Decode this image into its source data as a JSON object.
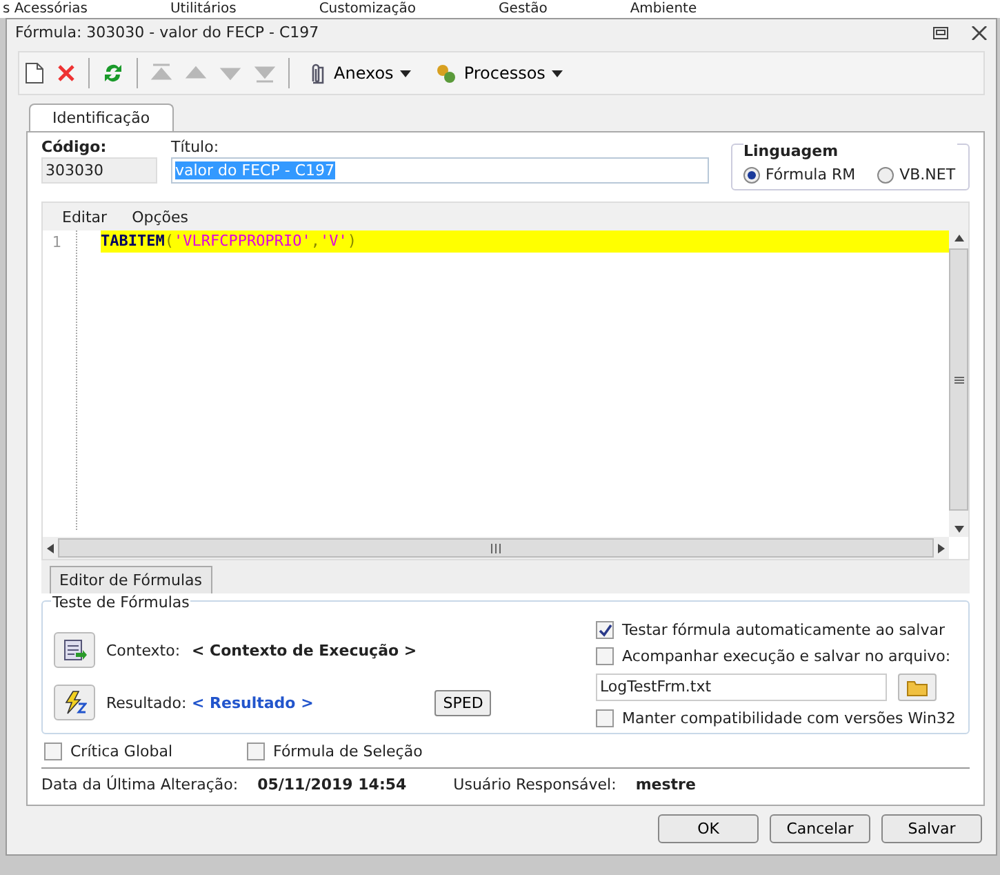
{
  "background_menu": [
    "s Acessórias",
    "Utilitários",
    "Customização",
    "Gestão",
    "Ambiente"
  ],
  "window": {
    "title": "Fórmula: 303030 - valor do FECP - C197"
  },
  "toolbar": [
    {
      "kind": "new",
      "disabled": false
    },
    {
      "kind": "delete",
      "disabled": false
    },
    {
      "kind": "refresh",
      "disabled": false
    },
    {
      "kind": "first",
      "disabled": true
    },
    {
      "kind": "up",
      "disabled": true
    },
    {
      "kind": "down",
      "disabled": true
    },
    {
      "kind": "last",
      "disabled": true
    }
  ],
  "toolbar_menus": [
    {
      "kind": "attach",
      "label": "Anexos"
    },
    {
      "kind": "process",
      "label": "Processos"
    }
  ],
  "tabs": [
    {
      "label": "Identificação",
      "selected": true
    }
  ],
  "codigo": {
    "label": "Código:",
    "value": "303030"
  },
  "titulo": {
    "label": "Título:",
    "value": "valor do FECP - C197"
  },
  "linguagem": {
    "title": "Linguagem",
    "options": [
      {
        "label": "Fórmula RM",
        "selected": true
      },
      {
        "label": "VB.NET",
        "selected": false
      }
    ]
  },
  "editor_menu": [
    "Editar",
    "Opções"
  ],
  "editor_lines": [
    {
      "number": "1",
      "tokens": [
        {
          "kind": "keyword",
          "text": "TABITEM"
        },
        {
          "kind": "punct",
          "text": "("
        },
        {
          "kind": "string",
          "text": "'VLRFCPPROPRIO'"
        },
        {
          "kind": "punct",
          "text": ","
        },
        {
          "kind": "string",
          "text": "'V'"
        },
        {
          "kind": "punct",
          "text": ")"
        }
      ]
    }
  ],
  "editor_tabs": [
    {
      "label": "Editor de Fórmulas"
    }
  ],
  "teste": {
    "title": "Teste de Fórmulas",
    "contexto_label": "Contexto:",
    "contexto_value": "< Contexto de Execução >",
    "resultado_label": "Resultado:",
    "resultado_value": "< Resultado >",
    "sped": "SPED",
    "options": [
      {
        "label": "Testar fórmula automaticamente ao salvar",
        "checked": true
      },
      {
        "label": "Acompanhar execução e salvar no arquivo:",
        "checked": false
      }
    ],
    "file": "LogTestFrm.txt",
    "compat": {
      "label": "Manter compatibilidade com versões Win32",
      "checked": false
    }
  },
  "flags": [
    {
      "label": "Crítica Global",
      "checked": false
    },
    {
      "label": "Fórmula de Seleção",
      "checked": false
    }
  ],
  "footer": {
    "date_label": "Data da Última Alteração:",
    "date": "05/11/2019 14:54",
    "user_label": "Usuário Responsável:",
    "user": "mestre"
  },
  "buttons": [
    {
      "label": "OK",
      "disabled": false
    },
    {
      "label": "Cancelar",
      "disabled": false
    },
    {
      "label": "Salvar",
      "disabled": false
    }
  ]
}
